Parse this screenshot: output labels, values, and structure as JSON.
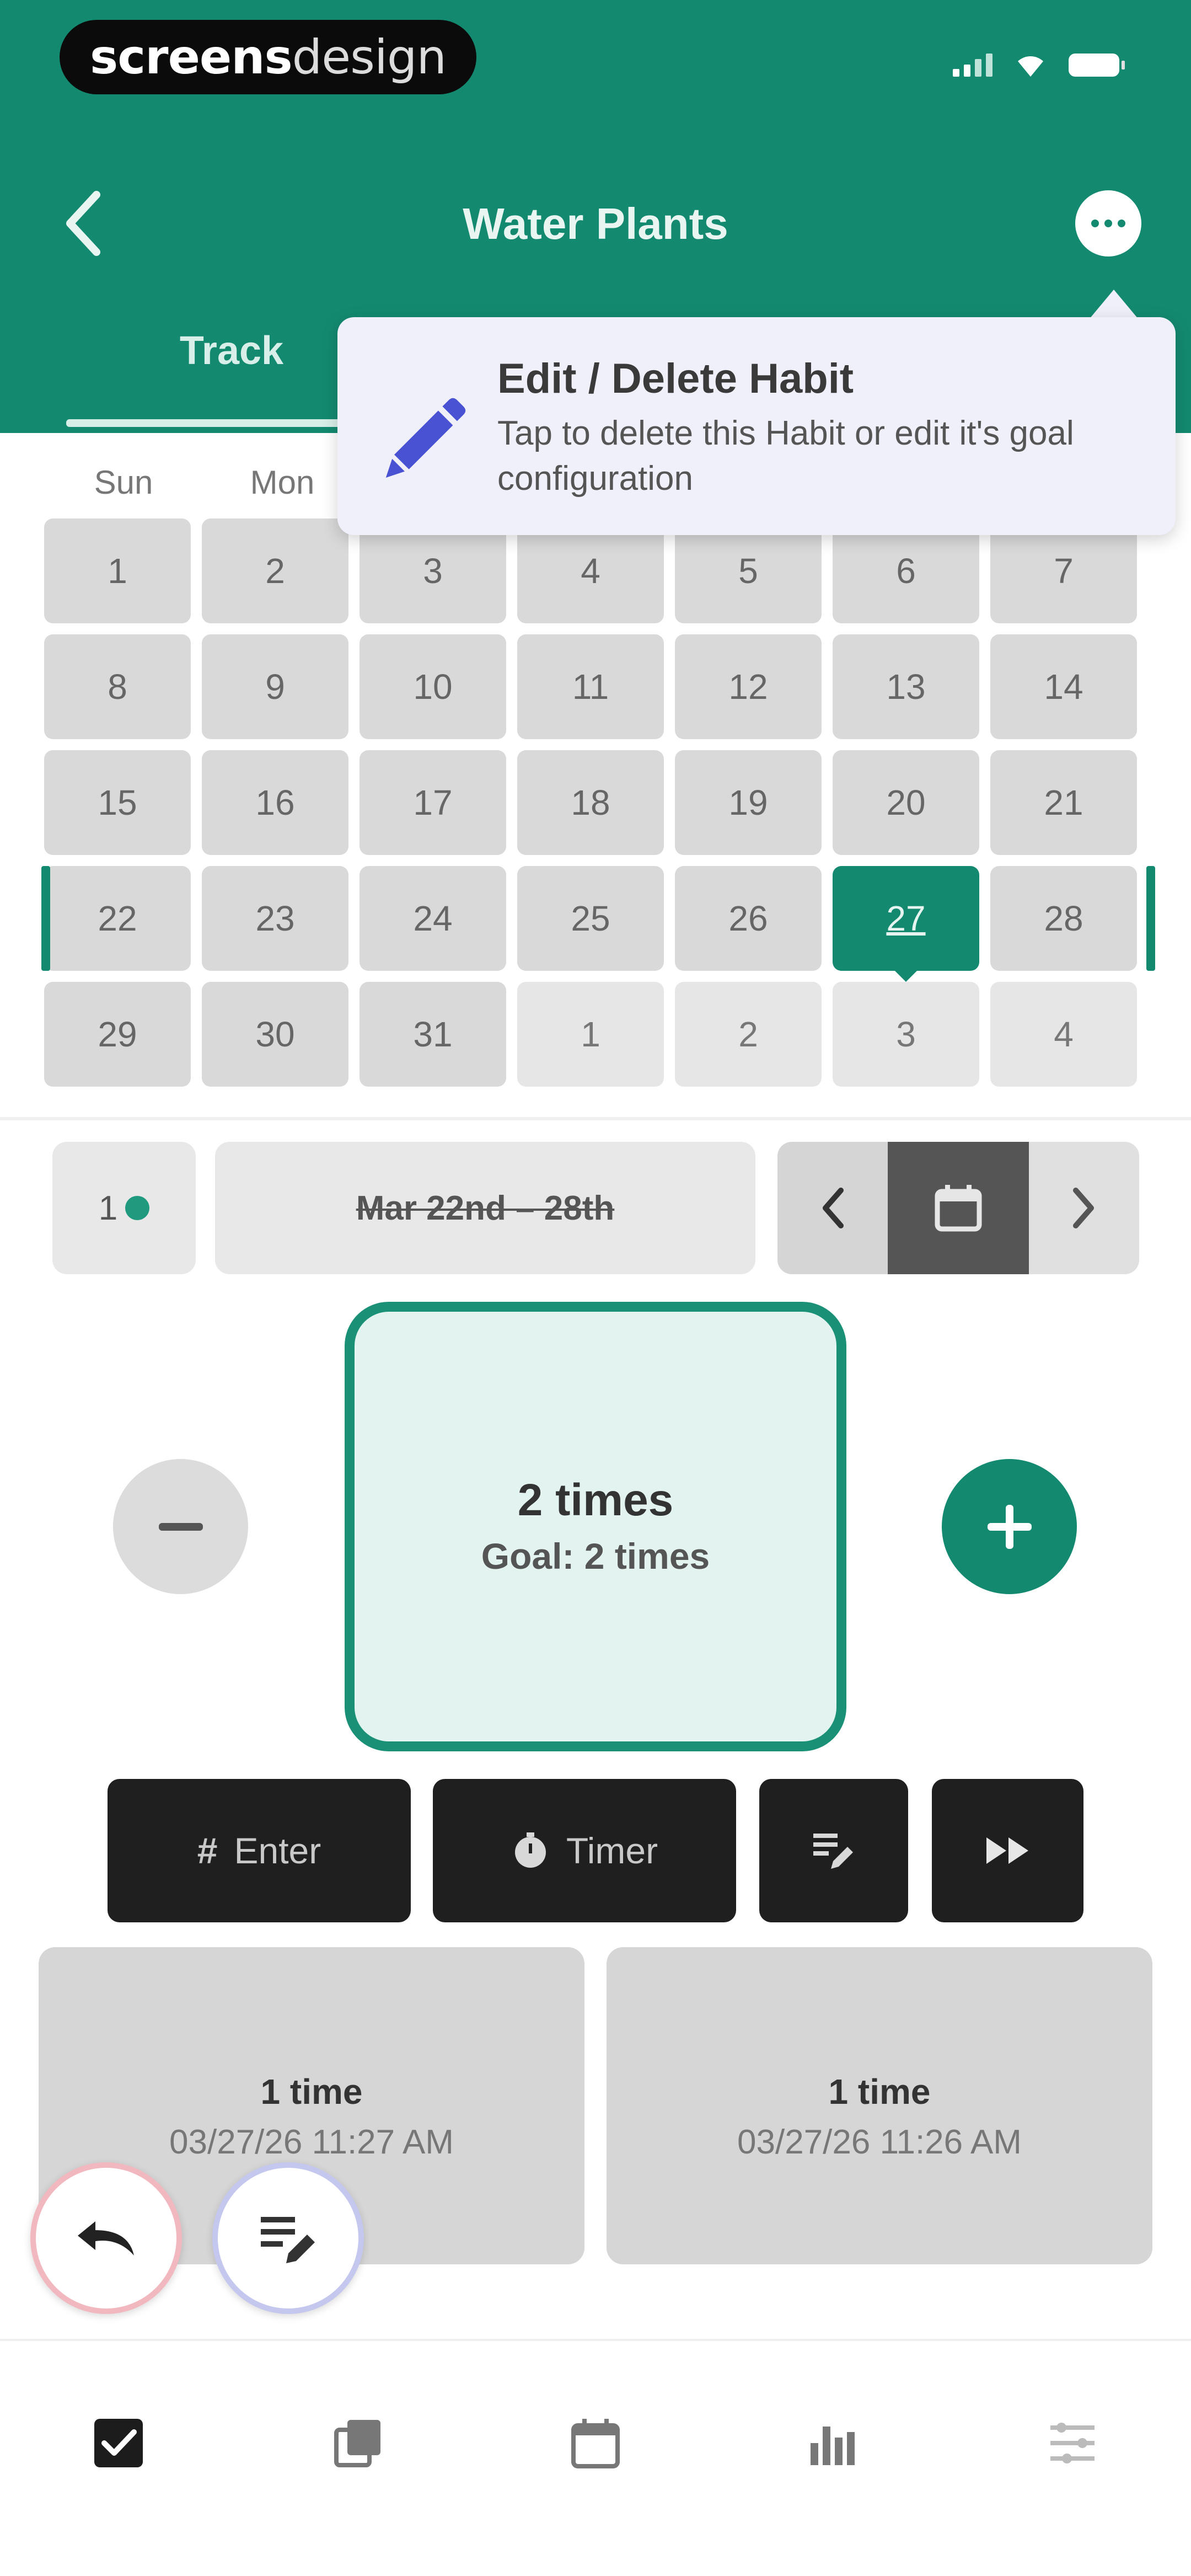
{
  "status_bar": {
    "brand_part1": "screens",
    "brand_part2": "design"
  },
  "header": {
    "title": "Water Plants"
  },
  "tabs": [
    {
      "label": "Track"
    }
  ],
  "tooltip": {
    "title": "Edit / Delete Habit",
    "text": "Tap to delete this Habit or edit it's goal configuration"
  },
  "calendar": {
    "weekdays": [
      "Sun",
      "Mon"
    ],
    "weeks": [
      [
        "1",
        "2",
        "3",
        "4",
        "5",
        "6",
        "7"
      ],
      [
        "8",
        "9",
        "10",
        "11",
        "12",
        "13",
        "14"
      ],
      [
        "15",
        "16",
        "17",
        "18",
        "19",
        "20",
        "21"
      ],
      [
        "22",
        "23",
        "24",
        "25",
        "26",
        "27",
        "28"
      ],
      [
        "29",
        "30",
        "31",
        "1",
        "2",
        "3",
        "4"
      ]
    ],
    "today": "27"
  },
  "navigation": {
    "streak": "1",
    "range": "Mar 22nd – 28th"
  },
  "counter": {
    "value": "2 times",
    "goal": "Goal: 2 times"
  },
  "actions": {
    "enter": "Enter",
    "timer": "Timer"
  },
  "entries": [
    {
      "count": "1 time",
      "time": "03/27/26 11:27 AM"
    },
    {
      "count": "1 time",
      "time": "03/27/26 11:26 AM"
    }
  ],
  "colors": {
    "primary": "#138a70",
    "tooltip_bg": "#f0f0fa",
    "dark_button": "#1f1f1f",
    "cell": "#d9d9d9"
  },
  "icons": {
    "back": "chevron-left-icon",
    "more": "more-icon",
    "edit": "pencil-icon",
    "calendar": "calendar-icon",
    "timer": "timer-icon",
    "skip": "fast-forward-icon",
    "undo": "undo-icon",
    "note": "note-edit-icon"
  }
}
